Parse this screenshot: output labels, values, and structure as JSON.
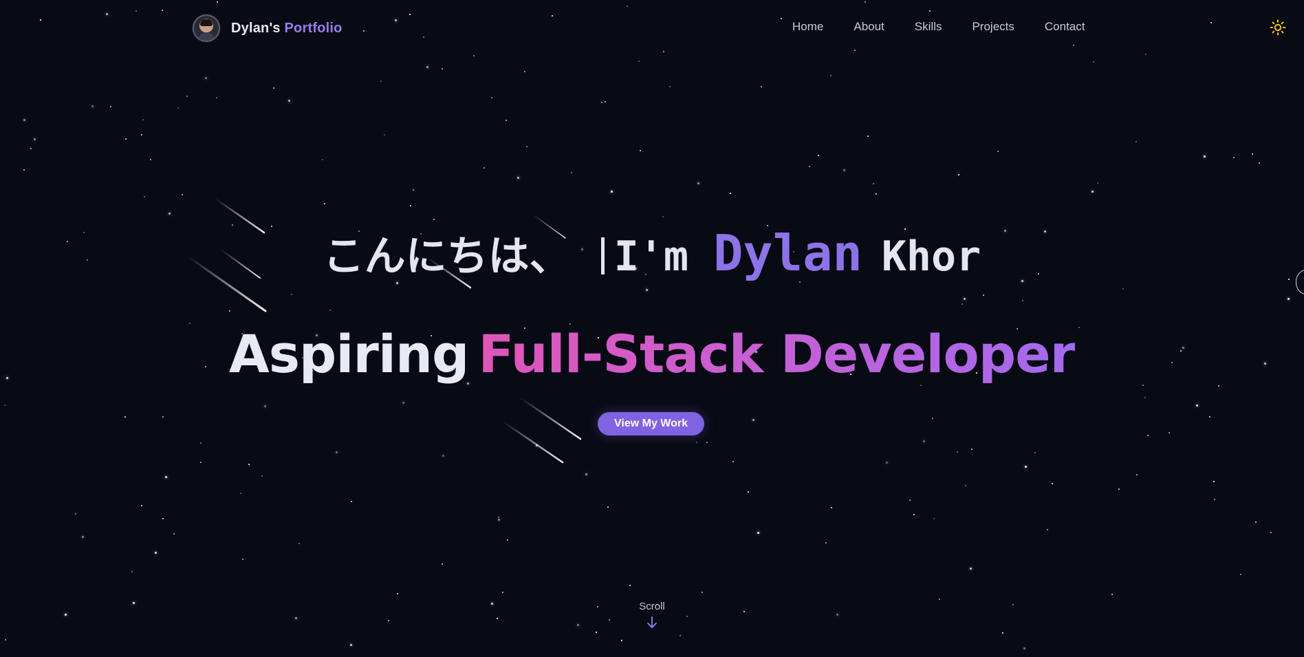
{
  "brand": {
    "name": "Dylan's",
    "accent": "Portfolio"
  },
  "nav": {
    "items": [
      "Home",
      "About",
      "Skills",
      "Projects",
      "Contact"
    ]
  },
  "hero": {
    "greeting": "こんにちは、",
    "intro": "I'm",
    "first_name": "Dylan",
    "last_name": "Khor",
    "prefix": "Aspiring",
    "role": "Full-Stack Developer",
    "cta_label": "View My Work"
  },
  "scroll": {
    "label": "Scroll"
  },
  "icons": {
    "theme": "sun-icon",
    "scroll": "arrow-down-icon",
    "side": "chevron-left-icon"
  },
  "colors": {
    "background": "#080a14",
    "accent": "#8d72e8",
    "button": "#7f63e3",
    "gradient_start": "#e055b8",
    "gradient_end": "#a36aee",
    "sun": "#f5c518"
  }
}
